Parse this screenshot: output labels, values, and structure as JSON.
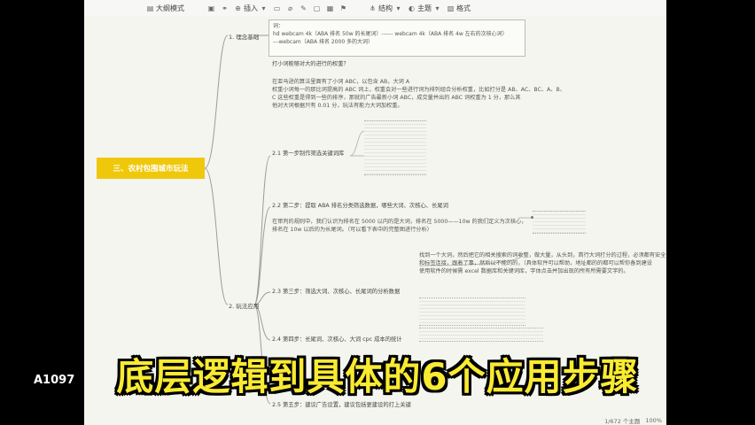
{
  "toolbar": {
    "items": [
      {
        "icon": "outline-icon",
        "label": "大纲模式"
      },
      {
        "icon": "image-icon",
        "label": ""
      },
      {
        "icon": "link-icon",
        "label": ""
      },
      {
        "icon": "insert-icon",
        "label": "插入"
      },
      {
        "icon": "video-icon",
        "label": ""
      },
      {
        "icon": "attach-icon",
        "label": ""
      },
      {
        "icon": "pen-icon",
        "label": ""
      },
      {
        "icon": "comment-icon",
        "label": ""
      },
      {
        "icon": "table-icon",
        "label": ""
      },
      {
        "icon": "flag-icon",
        "label": ""
      },
      {
        "icon": "structure-icon",
        "label": "结构"
      },
      {
        "icon": "theme-icon",
        "label": "主题"
      },
      {
        "icon": "format-icon",
        "label": "格式"
      }
    ]
  },
  "mindmap": {
    "root": "三、农村包围城市玩法",
    "branch1": "1. 理念基础",
    "branch2": "2. 玩法应用",
    "note_lines": [
      "词：",
      "hd webcam 4k（ABA 排名 50w 的长尾词）------ webcam 4k（ABA 排名 4w 左右的次核心词）",
      "---webcam（ABA 排名 2000 多的大词）"
    ],
    "q1": "打小词能够对大的进行的权重？",
    "p1": "在亚马逊的算法里面有了小词 ABC，以包含 AB，大词 A",
    "p2": "权重小词每一的那比词提高的 ABC 词上，权重会对一些进行词为排列组合分析权重，比如打分是 AB、AC、BC、A、B、",
    "p3": "C 这些权重是得到一些的排序，那就的广告最新小词 ABC，成交量并出的 ABC 词权重为 1 分，那么其",
    "p4": "他对大词根据只有 0.01 分，玩法有能力大词加权重。",
    "step1": "2.1 第一步制作筛选关键词库",
    "step2": "2.2 第二步：提取 ABA 排名分类筛选数据，哪些大词、次核心、长尾词",
    "step2_p1": "在审判的规则中，我们认识为排名在 5000 以内的是大词，排名在 5000——10w 的我们定义为次核心，",
    "step2_p2": "排名在 10w 以后的为长尾词。（可以看下表中的完整图进行分析）",
    "step2_right1": "找到一个大词，然后把它的相关搜索的词收整，做大量，从头到，首行大词打分的过程，必须都有安全",
    "step2_right2": "和标签连接，跟着了事，然后以不能的的，（具体软件可以帮助，地址都的的都可以帮你备到建设",
    "step2_right3": "使用软件的时候需 excel 数据库和关键词库，字体点击并加出现的所有所需要文字的。",
    "step3": "2.3 第三步：筛选大词、次核心、长尾词的分析数据",
    "step4": "2.4 第四步：长尾词、次核心、大词 cpc 成本的统计",
    "step5": "2.5 第五步：建议广告设置，建议包括更建设的打上关键"
  },
  "watermark": "A1097",
  "subtitle": "底层逻辑到具体的6个应用步骤",
  "status": {
    "count": "1/672 个主题",
    "zoom": "100%"
  }
}
